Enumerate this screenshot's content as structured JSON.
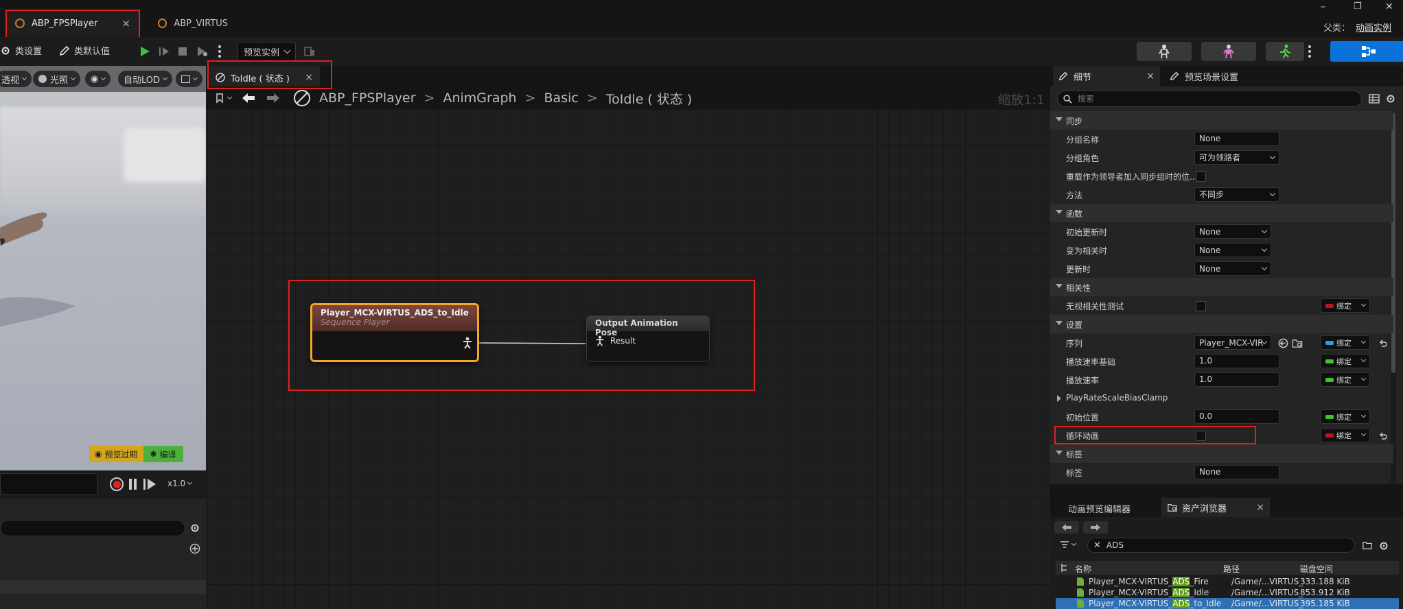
{
  "window": {
    "tabs": [
      {
        "label": "ABP_FPSPlayer"
      },
      {
        "label": "ABP_VIRTUS"
      }
    ],
    "close_glyph": "×",
    "parent_label": "父类：",
    "parent_link": "动画实例",
    "controls": {
      "minimize": "–",
      "restore": "❐",
      "close": "✕"
    }
  },
  "toolbar": {
    "class_settings": "类设置",
    "class_defaults": "类默认值",
    "preview_instance": "预览实例"
  },
  "viewport": {
    "perspective": "透视",
    "lighting": "光照",
    "auto_lod": "自动LOD",
    "preview_outdated": "预览过期",
    "compile": "编译",
    "speed": "x1.0"
  },
  "graph": {
    "tab_label": "ToIdle ( 状态 )",
    "breadcrumb": [
      "ABP_FPSPlayer",
      "AnimGraph",
      "Basic",
      "ToIdle ( 状态 )"
    ],
    "zoom": "缩放1:1",
    "sequence_node": {
      "title": "Player_MCX-VIRTUS_ADS_to_Idle",
      "subtitle": "Sequence Player"
    },
    "output_node": {
      "title": "Output Animation Pose",
      "pin": "Result"
    }
  },
  "details": {
    "tab_details": "细节",
    "tab_preview_scene": "预览场景设置",
    "search_placeholder": "搜索",
    "bind_label": "绑定",
    "categories": {
      "sync": "同步",
      "functions": "函数",
      "relevancy": "相关性",
      "settings": "设置",
      "tags": "标签"
    },
    "props": {
      "group_name": {
        "label": "分组名称",
        "value": "None"
      },
      "group_role": {
        "label": "分组角色",
        "value": "可为领路者"
      },
      "override_leader": {
        "label": "重载作为领导者加入同步组时的位..."
      },
      "method": {
        "label": "方法",
        "value": "不同步"
      },
      "initial_update": {
        "label": "初始更新时",
        "value": "None"
      },
      "become_relevant": {
        "label": "变为相关时",
        "value": "None"
      },
      "on_update": {
        "label": "更新时",
        "value": "None"
      },
      "ignore_relevancy": {
        "label": "无视相关性测试"
      },
      "sequence": {
        "label": "序列",
        "value": "Player_MCX-VIR"
      },
      "play_rate_basis": {
        "label": "播放速率基础",
        "value": "1.0"
      },
      "play_rate": {
        "label": "播放速率",
        "value": "1.0"
      },
      "play_rate_clamp": {
        "label": "PlayRateScaleBiasClamp"
      },
      "start_position": {
        "label": "初始位置",
        "value": "0.0"
      },
      "loop_animation": {
        "label": "循环动画"
      },
      "tag": {
        "label": "标签",
        "value": "None"
      }
    },
    "colors": {
      "bind_red": "#c0131a",
      "bind_green": "#3fc52a",
      "bind_blue": "#2a9fe0"
    }
  },
  "assets": {
    "tab_anim_preview": "动画预览编辑器",
    "tab_asset_browser": "资产浏览器",
    "filter_text": "ADS",
    "columns": {
      "name": "名称",
      "path": "路径",
      "disk": "磁盘空间"
    },
    "rows": [
      {
        "pre": "Player_MCX-VIRTUS_",
        "hl": "ADS",
        "post": "_Fire",
        "path": "/Game/...VIRTUS_",
        "size": "333.188 KiB"
      },
      {
        "pre": "Player_MCX-VIRTUS_",
        "hl": "ADS",
        "post": "_Idle",
        "path": "/Game/...VIRTUS_",
        "size": "853.912 KiB"
      },
      {
        "pre": "Player_MCX-VIRTUS_",
        "hl": "ADS",
        "post": "_to_Idle",
        "path": "/Game/...VIRTUS_",
        "size": "395.185 KiB"
      }
    ]
  }
}
